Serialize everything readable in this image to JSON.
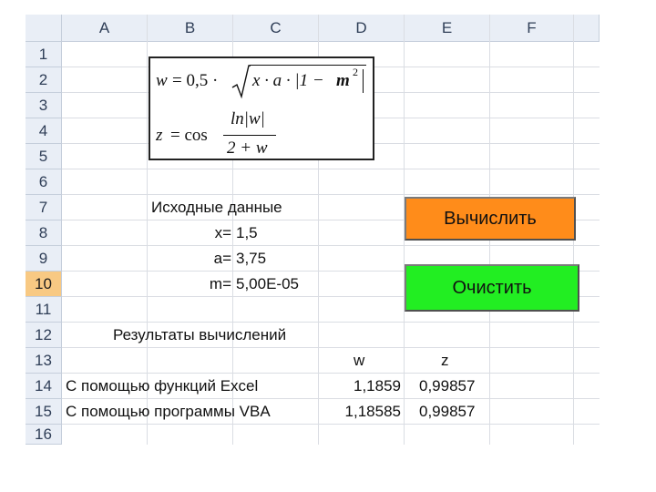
{
  "columns": [
    "A",
    "B",
    "C",
    "D",
    "E",
    "F"
  ],
  "rows": [
    "1",
    "2",
    "3",
    "4",
    "5",
    "6",
    "7",
    "8",
    "9",
    "10",
    "11",
    "12",
    "13",
    "14",
    "15",
    "16"
  ],
  "selected_row": "10",
  "formula": {
    "w_lhs": "w",
    "w_eq": "= 0,5 ·",
    "w_rad": "x · a · |1 −",
    "w_m": "m",
    "w_exp": "2",
    "z_lhs": "z",
    "z_eq": "= cos",
    "z_num": "ln|w|",
    "z_den": "2 + w"
  },
  "inputs": {
    "title": "Исходные данные",
    "x_label": "x=",
    "x_value": "1,5",
    "a_label": "a=",
    "a_value": "3,75",
    "m_label": "m=",
    "m_value": "5,00E-05"
  },
  "results": {
    "title": "Результаты вычислений",
    "col_w": "w",
    "col_z": "z",
    "row1_label": "С помощью функций Excel",
    "row1_w": "1,1859",
    "row1_z": "0,99857",
    "row2_label": "С помощью программы VBA",
    "row2_w": "1,18585",
    "row2_z": "0,99857"
  },
  "buttons": {
    "calc_label": "Вычислить",
    "clear_label": "Очистить"
  },
  "colors": {
    "calc_button": "#ff8c1a",
    "clear_button": "#22ee22"
  }
}
